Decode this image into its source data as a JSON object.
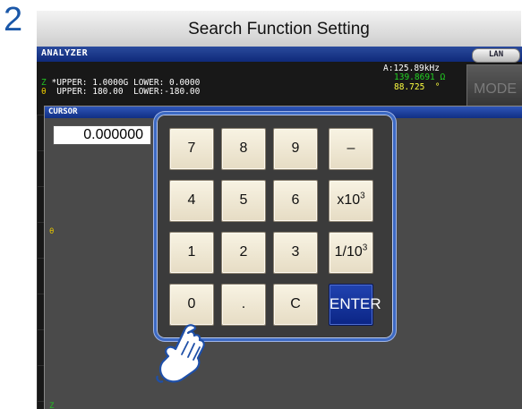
{
  "step_number": "2",
  "title": "Search Function Setting",
  "analyzer": {
    "label": "ANALYZER",
    "lan_label": "LAN",
    "frequency": "A:125.89kHz",
    "z_symbol": "Z",
    "z_limits": "*UPPER: 1.0000G LOWER: 0.0000",
    "theta_symbol": "θ",
    "theta_limits": "UPPER: 180.00  LOWER:-180.00",
    "z_value": "139.8691 Ω",
    "theta_value": "88.725  °",
    "mode_label": "MODE",
    "left_theta": "θ",
    "left_z": "Z"
  },
  "cursor_dialog": {
    "label": "CURSOR",
    "value": "0.000000"
  },
  "keypad": {
    "keys": [
      "7",
      "8",
      "9",
      "–",
      "4",
      "5",
      "6",
      "x10",
      "1",
      "2",
      "3",
      "1/10",
      "0",
      ".",
      "C",
      "ENTER"
    ],
    "exponent": "3"
  },
  "colors": {
    "accent_blue": "#1a57a8",
    "enter_key": "#0b2585",
    "z_green": "#22c022",
    "theta_yellow": "#e0c000"
  },
  "icons": [
    "pointing-hand-icon"
  ]
}
